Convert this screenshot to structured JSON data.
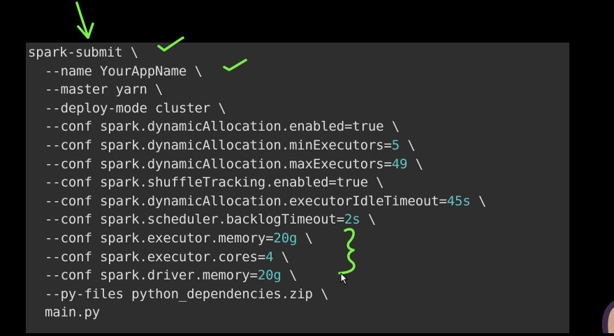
{
  "command": {
    "lines": [
      {
        "indent": false,
        "parts": [
          {
            "t": "spark-submit \\",
            "c": "plain"
          }
        ]
      },
      {
        "indent": true,
        "parts": [
          {
            "t": "--name YourAppName \\",
            "c": "plain"
          }
        ]
      },
      {
        "indent": true,
        "parts": [
          {
            "t": "--master yarn \\",
            "c": "plain"
          }
        ]
      },
      {
        "indent": true,
        "parts": [
          {
            "t": "--deploy-mode cluster \\",
            "c": "plain"
          }
        ]
      },
      {
        "indent": true,
        "parts": [
          {
            "t": "--conf spark",
            "c": "plain"
          },
          {
            "t": ".",
            "c": "op"
          },
          {
            "t": "dynamicAllocation",
            "c": "plain"
          },
          {
            "t": ".",
            "c": "op"
          },
          {
            "t": "enabled=true \\",
            "c": "plain"
          }
        ]
      },
      {
        "indent": true,
        "parts": [
          {
            "t": "--conf spark",
            "c": "plain"
          },
          {
            "t": ".",
            "c": "op"
          },
          {
            "t": "dynamicAllocation",
            "c": "plain"
          },
          {
            "t": ".",
            "c": "op"
          },
          {
            "t": "minExecutors=",
            "c": "plain"
          },
          {
            "t": "5",
            "c": "num"
          },
          {
            "t": " \\",
            "c": "plain"
          }
        ]
      },
      {
        "indent": true,
        "parts": [
          {
            "t": "--conf spark",
            "c": "plain"
          },
          {
            "t": ".",
            "c": "op"
          },
          {
            "t": "dynamicAllocation",
            "c": "plain"
          },
          {
            "t": ".",
            "c": "op"
          },
          {
            "t": "maxExecutors=",
            "c": "plain"
          },
          {
            "t": "49",
            "c": "num"
          },
          {
            "t": " \\",
            "c": "plain"
          }
        ]
      },
      {
        "indent": true,
        "parts": [
          {
            "t": "--conf spark",
            "c": "plain"
          },
          {
            "t": ".",
            "c": "op"
          },
          {
            "t": "shuffleTracking",
            "c": "plain"
          },
          {
            "t": ".",
            "c": "op"
          },
          {
            "t": "enabled=true \\",
            "c": "plain"
          }
        ]
      },
      {
        "indent": true,
        "parts": [
          {
            "t": "--conf spark",
            "c": "plain"
          },
          {
            "t": ".",
            "c": "op"
          },
          {
            "t": "dynamicAllocation",
            "c": "plain"
          },
          {
            "t": ".",
            "c": "op"
          },
          {
            "t": "executorIdleTimeout=",
            "c": "plain"
          },
          {
            "t": "45s",
            "c": "num"
          },
          {
            "t": " \\",
            "c": "plain"
          }
        ]
      },
      {
        "indent": true,
        "parts": [
          {
            "t": "--conf spark",
            "c": "plain"
          },
          {
            "t": ".",
            "c": "op"
          },
          {
            "t": "scheduler",
            "c": "plain"
          },
          {
            "t": ".",
            "c": "op"
          },
          {
            "t": "backlogTimeout=",
            "c": "plain"
          },
          {
            "t": "2s",
            "c": "num"
          },
          {
            "t": " \\",
            "c": "plain"
          }
        ]
      },
      {
        "indent": true,
        "parts": [
          {
            "t": "--conf spark",
            "c": "plain"
          },
          {
            "t": ".",
            "c": "op"
          },
          {
            "t": "executor",
            "c": "plain"
          },
          {
            "t": ".",
            "c": "op"
          },
          {
            "t": "memory=",
            "c": "plain"
          },
          {
            "t": "20g",
            "c": "num"
          },
          {
            "t": " \\",
            "c": "plain"
          }
        ]
      },
      {
        "indent": true,
        "parts": [
          {
            "t": "--conf spark",
            "c": "plain"
          },
          {
            "t": ".",
            "c": "op"
          },
          {
            "t": "executor",
            "c": "plain"
          },
          {
            "t": ".",
            "c": "op"
          },
          {
            "t": "cores=",
            "c": "plain"
          },
          {
            "t": "4",
            "c": "num"
          },
          {
            "t": " \\",
            "c": "plain"
          }
        ]
      },
      {
        "indent": true,
        "parts": [
          {
            "t": "--conf spark",
            "c": "plain"
          },
          {
            "t": ".",
            "c": "op"
          },
          {
            "t": "driver",
            "c": "plain"
          },
          {
            "t": ".",
            "c": "op"
          },
          {
            "t": "memory=",
            "c": "plain"
          },
          {
            "t": "20g",
            "c": "num"
          },
          {
            "t": " \\",
            "c": "plain"
          }
        ]
      },
      {
        "indent": true,
        "parts": [
          {
            "t": "--py-files python_dependencies",
            "c": "plain"
          },
          {
            "t": ".",
            "c": "op"
          },
          {
            "t": "zip \\",
            "c": "plain"
          }
        ]
      },
      {
        "indent": true,
        "parts": [
          {
            "t": "main",
            "c": "plain"
          },
          {
            "t": ".",
            "c": "op"
          },
          {
            "t": "py",
            "c": "plain"
          }
        ]
      }
    ]
  },
  "colors": {
    "background": "#000000",
    "panel": "#2e2e2e",
    "text": "#dcdcdc",
    "number": "#5fc6c6",
    "annotation": "#7cf04a"
  },
  "annotations": {
    "items": [
      "arrow-down",
      "checkmark",
      "checkmark",
      "curly-brace"
    ]
  },
  "cursor": {
    "icon": "mouse-pointer-icon"
  }
}
